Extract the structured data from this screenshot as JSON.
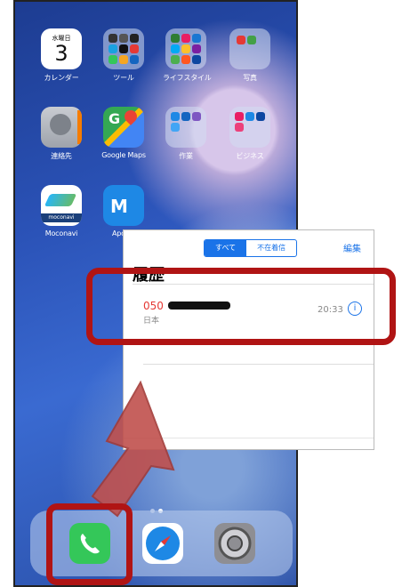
{
  "home": {
    "calendar": {
      "weekday": "水曜日",
      "day": "3",
      "label": "カレンダー"
    },
    "tools_label": "ツール",
    "lifestyle_label": "ライフスタイル",
    "photos_label": "写真",
    "contacts_label": "連絡先",
    "maps_label": "Google Maps",
    "work_label": "作業",
    "business_label": "ビジネス",
    "moconavi": {
      "logo_text": "moconavi",
      "label": "Moconavi"
    },
    "apower_label": "Apowe"
  },
  "dock": {
    "apps": [
      "phone-icon",
      "safari-icon",
      "settings-icon"
    ]
  },
  "recents": {
    "segments": [
      "すべて",
      "不在着信"
    ],
    "edit_label": "編集",
    "title": "履歴",
    "entry": {
      "number_prefix": "050",
      "region": "日本",
      "time": "20:33"
    }
  },
  "colors": {
    "accent": "#1a73e8",
    "missed": "#e53935",
    "highlight": "#b01414",
    "arrow": "#c0504d"
  }
}
